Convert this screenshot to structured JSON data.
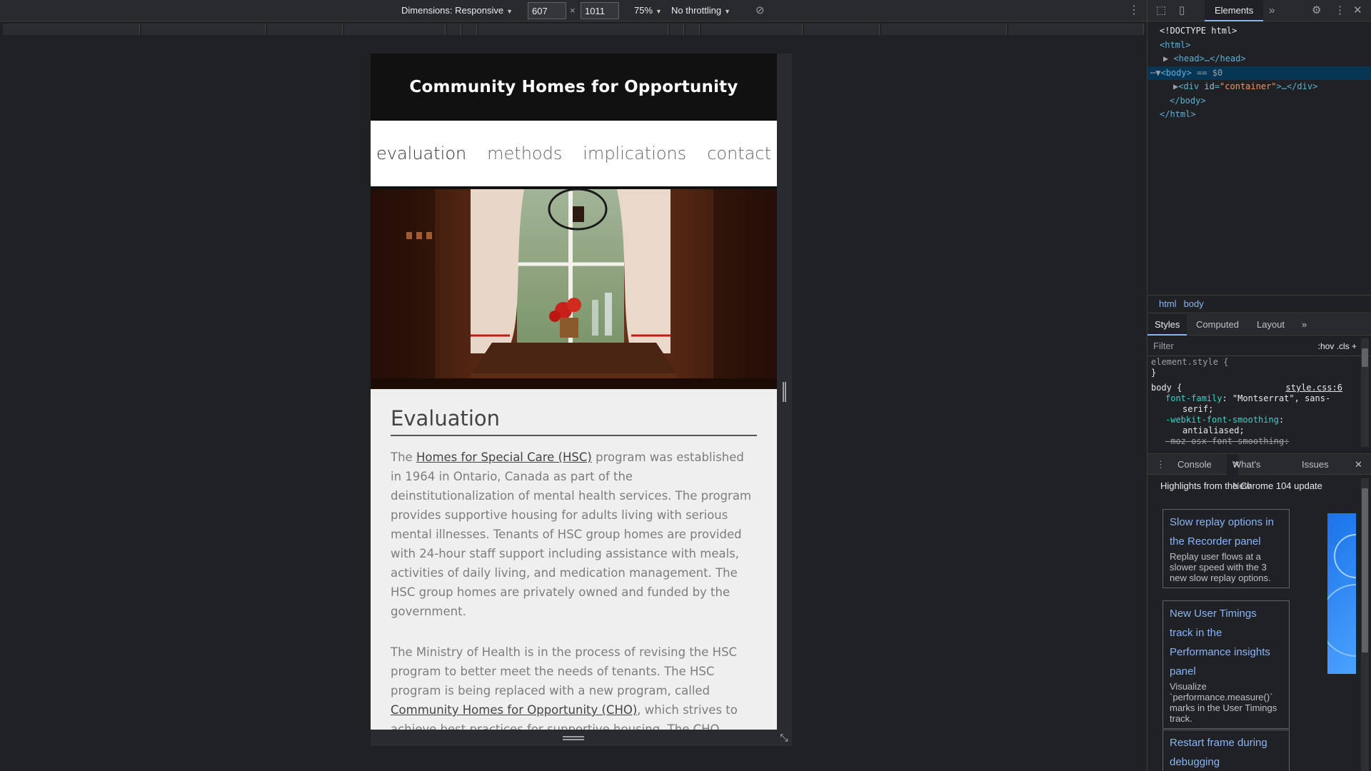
{
  "toolbar": {
    "dimensions_label": "Dimensions: Responsive",
    "width_value": "607",
    "times": "×",
    "height_value": "1011",
    "zoom": "75%",
    "throttling": "No throttling"
  },
  "site": {
    "title": "Community Homes for Opportunity",
    "nav": [
      "evaluation",
      "methods",
      "implications",
      "contact"
    ],
    "section_title": "Evaluation",
    "p1_before": "The ",
    "p1_link": "Homes for Special Care (HSC)",
    "p1_after": " program was established in 1964 in Ontario, Canada as part of the deinstitutionalization of mental health services. The program provides supportive housing for adults living with serious mental illnesses. Tenants of HSC group homes are provided with 24-hour staff support including assistance with meals, activities of daily living, and medication management. The HSC group homes are privately owned and funded by the government.",
    "p2_before": "The Ministry of Health is in the process of revising the HSC program to better meet the needs of tenants. The HSC program is being replaced with a new program, called ",
    "p2_link": "Community Homes for Opportunity (CHO)",
    "p2_after": ", which strives to achieve best practices for supportive housing. The CHO program aims to help tenants to:"
  },
  "devtools": {
    "main_tab": "Elements",
    "dom": {
      "doctype": "<!DOCTYPE html>",
      "html_open": "<html>",
      "head": "<head>…</head>",
      "body_open": "<body>",
      "body_marker": " == $0",
      "div_open": "<div ",
      "div_attr_name": "id",
      "div_attr_value": "\"container\"",
      "div_close": ">…</div>",
      "body_close": "</body>",
      "html_close": "</html>"
    },
    "breadcrumbs": [
      "html",
      "body"
    ],
    "styles_tabs": [
      "Styles",
      "Computed",
      "Layout"
    ],
    "filter_placeholder": "Filter",
    "filter_tools": ":hov  .cls  +",
    "styles": {
      "element_style_open": "element.style {",
      "close": "}",
      "body_selector": "body {",
      "source": "style.css:6",
      "prop1_name": "font-family",
      "prop1_value": ": \"Montserrat\", sans-",
      "prop1_cont": "serif;",
      "prop2_name": "-webkit-font-smoothing",
      "prop2_value": ":",
      "prop2_cont": "antialiased;",
      "prop3_name": "-moz-osx-font-smoothing:"
    },
    "drawer_tabs": [
      "Console",
      "What's New",
      "Issues"
    ],
    "whats_new_heading": "Highlights from the Chrome 104 update",
    "cards": [
      {
        "title": "Slow replay options in the Recorder panel",
        "desc": "Replay user flows at a slower speed with the 3 new slow replay options."
      },
      {
        "title": "New User Timings track in the Performance insights panel",
        "desc": "Visualize `performance.measure()` marks in the User Timings track."
      },
      {
        "title": "Restart frame during debugging",
        "desc": ""
      }
    ]
  }
}
